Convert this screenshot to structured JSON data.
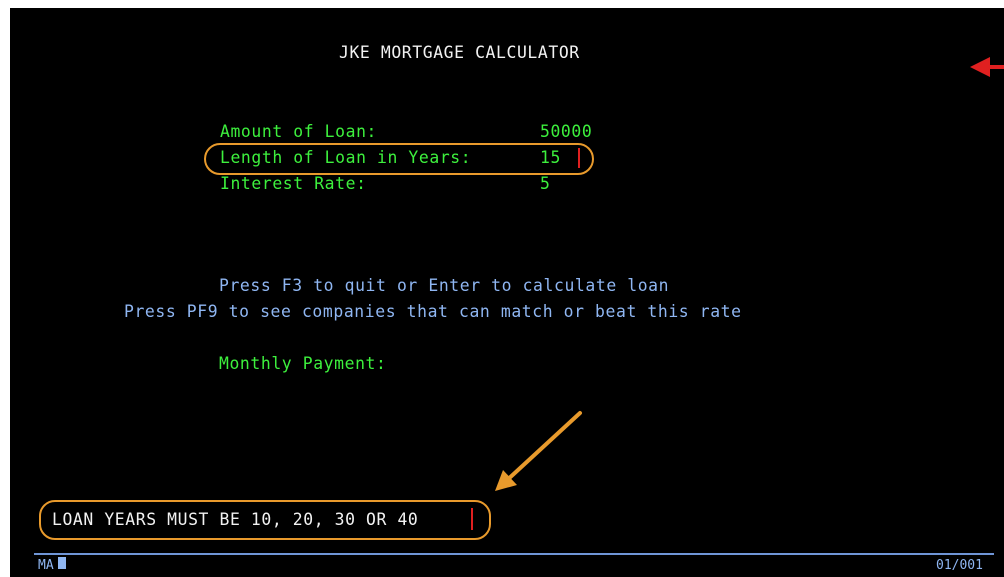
{
  "screen": {
    "title": "JKE MORTGAGE CALCULATOR",
    "fields": [
      {
        "label": "Amount of Loan:",
        "value": "50000"
      },
      {
        "label": "Length of Loan in Years:",
        "value": "15"
      },
      {
        "label": "Interest Rate:",
        "value": "5"
      }
    ],
    "instructions": [
      "Press F3 to quit or Enter to calculate loan",
      "Press PF9 to see companies that can match or beat this rate"
    ],
    "monthly_payment_label": "Monthly Payment:",
    "error_message": "LOAN YEARS MUST BE 10, 20, 30 OR 40"
  },
  "status_bar": {
    "mode": "MA",
    "position": "01/001"
  },
  "colors": {
    "terminal_bg": "#000000",
    "title": "#f2f2f2",
    "field_text": "#3df03d",
    "instruction_text": "#8fb6f2",
    "annotation_orange": "#e89a2c",
    "annotation_red": "#e02020"
  }
}
